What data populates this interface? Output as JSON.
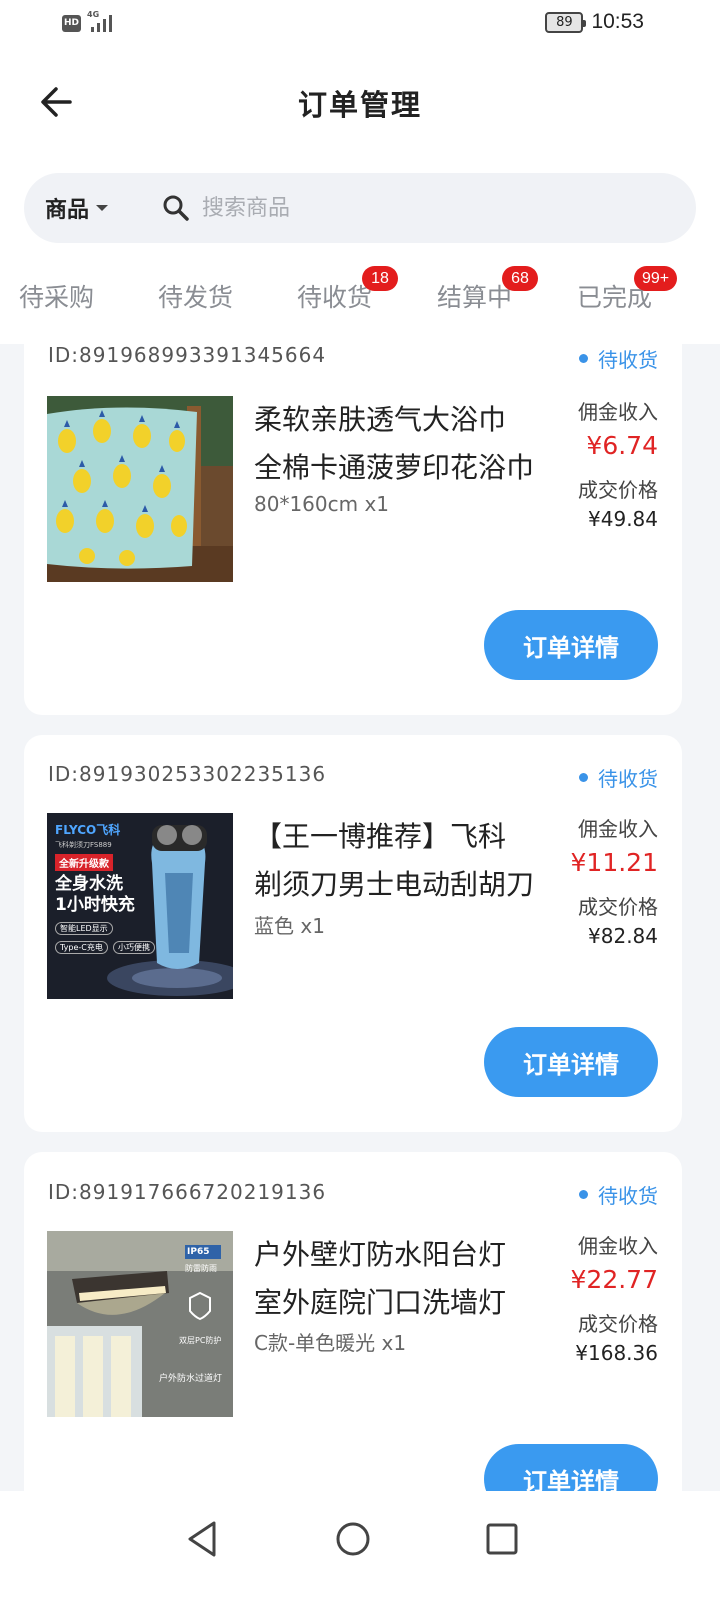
{
  "status_bar": {
    "hd": "HD",
    "network": "4G",
    "battery": "89",
    "time": "10:53"
  },
  "header": {
    "title": "订单管理",
    "back_icon": "arrow-left-icon"
  },
  "search": {
    "category": "商品",
    "placeholder": "搜索商品"
  },
  "tabs": [
    {
      "label": "待采购",
      "badge": ""
    },
    {
      "label": "待发货",
      "badge": ""
    },
    {
      "label": "待收货",
      "badge": "18"
    },
    {
      "label": "结算中",
      "badge": "68"
    },
    {
      "label": "已完成",
      "badge": "99+"
    }
  ],
  "labels": {
    "commission": "佣金收入",
    "deal_price": "成交价格",
    "detail_button": "订单详情"
  },
  "orders": [
    {
      "id": "ID:891968993391345664",
      "status": "待收货",
      "name_line1": "柔软亲肤透气大浴巾",
      "name_line2": "全棉卡通菠萝印花浴巾",
      "spec": "80*160cm x1",
      "commission": "¥6.74",
      "price": "¥49.84"
    },
    {
      "id": "ID:891930253302235136",
      "status": "待收货",
      "name_line1": "【王一博推荐】飞科",
      "name_line2": "剃须刀男士电动刮胡刀",
      "spec": "蓝色 x1",
      "commission": "¥11.21",
      "price": "¥82.84",
      "image_text": {
        "brand": "FLYCO飞科",
        "model": "飞科剃须刀FS889",
        "tag": "全新升级款",
        "headline1": "全身水洗",
        "headline2": "1小时快充",
        "feature1": "智能LED显示",
        "feature2": "Type-C充电",
        "feature3": "小巧便携"
      }
    },
    {
      "id": "ID:891917666720219136",
      "status": "待收货",
      "name_line1": "户外壁灯防水阳台灯",
      "name_line2": "室外庭院门口洗墙灯",
      "spec": "C款-单色暖光 x1",
      "commission": "¥22.77",
      "price": "¥168.36",
      "image_text": {
        "ip": "IP65",
        "waterproof": "防雷防雨",
        "pc": "双层PC防护",
        "caption": "户外防水过道灯"
      }
    }
  ],
  "colors": {
    "accent": "#3a9af0",
    "status_blue": "#3a93e8",
    "price_red": "#e02424",
    "badge_red": "#e31d1d"
  },
  "nav": {
    "back": "triangle-back-icon",
    "home": "circle-home-icon",
    "recents": "square-recents-icon"
  }
}
